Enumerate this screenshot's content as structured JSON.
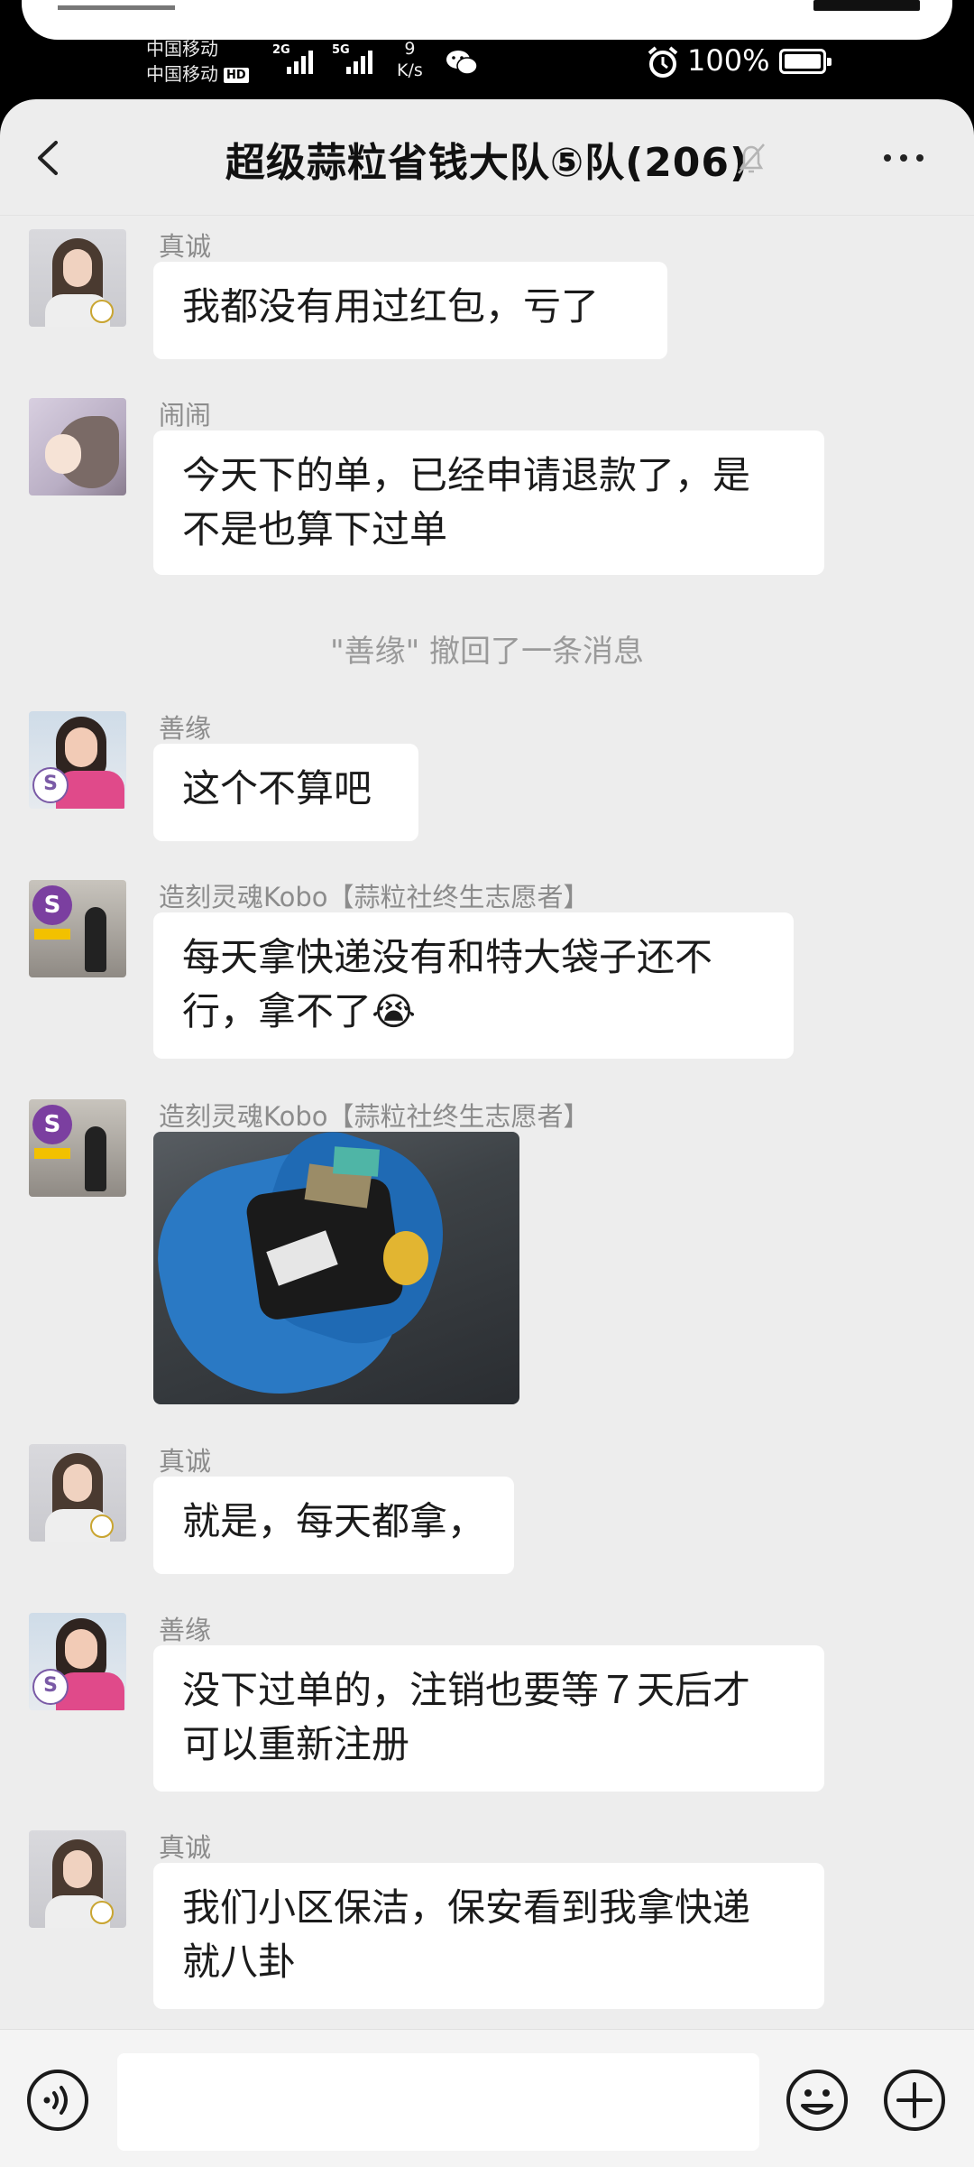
{
  "status_bar": {
    "carrier1": "中国移动",
    "carrier2": "中国移动",
    "hd_badge": "HD",
    "net1": "2G",
    "net2": "5G",
    "speed_value": "9",
    "speed_unit": "K/s",
    "battery_percent": "100%"
  },
  "header": {
    "title": "超级蒜粒省钱大队⑤队(206)"
  },
  "messages": [
    {
      "sender": "真诚",
      "text": "我都没有用过红包，亏了"
    },
    {
      "sender": "闹闹",
      "line1": "今天下的单，已经申请退款了，是",
      "line2": "不是也算下过单"
    },
    {
      "system": "\"善缘\" 撤回了一条消息"
    },
    {
      "sender": "善缘",
      "text": "这个不算吧"
    },
    {
      "sender": "造刻灵魂Kobo【蒜粒社终生志愿者】",
      "line1": "每天拿快递没有和特大袋子还不",
      "line2": "行，拿不了😭"
    },
    {
      "sender": "造刻灵魂Kobo【蒜粒社终生志愿者】",
      "image": "photo-blue-plastic-bag-with-parcels"
    },
    {
      "sender": "真诚",
      "text": "就是，每天都拿，"
    },
    {
      "sender": "善缘",
      "line1": "没下过单的，注销也要等７天后才",
      "line2": "可以重新注册"
    },
    {
      "sender": "真诚",
      "line1": "我们小区保洁，保安看到我拿快递",
      "line2": "就八卦"
    }
  ],
  "input": {
    "placeholder": ""
  },
  "colors": {
    "panel_bg": "#ededed",
    "bubble_bg": "#ffffff",
    "sender_gray": "#8c8c8c"
  }
}
